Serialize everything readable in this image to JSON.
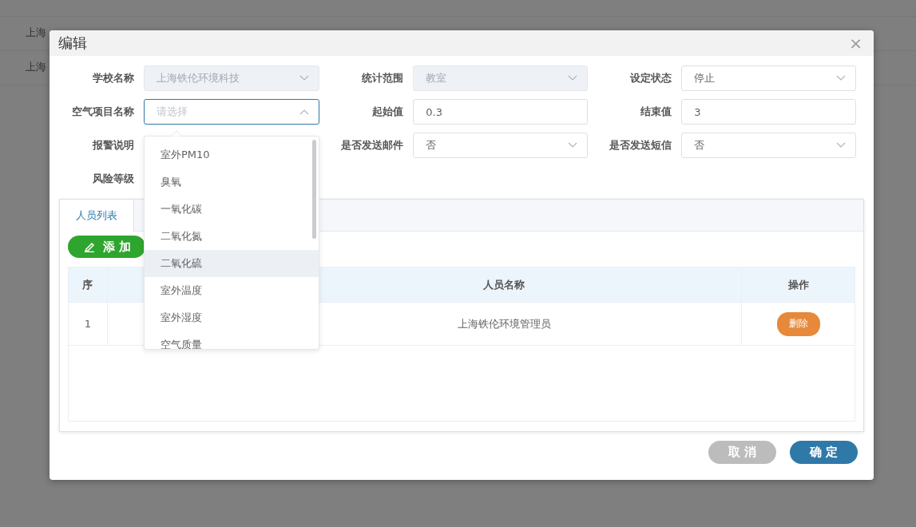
{
  "background_table": {
    "rows": [
      {
        "cells": [
          {
            "text": "上海"
          }
        ]
      },
      {
        "cells": [
          {
            "text": "上海"
          }
        ]
      }
    ]
  },
  "dialog": {
    "title": "编辑",
    "close": "×",
    "fields": [
      {
        "label": "学校名称",
        "kind": "select",
        "value": "上海铁伦环境科技",
        "disabled": true,
        "open": false
      },
      {
        "label": "统计范围",
        "kind": "select",
        "value": "教室",
        "disabled": true,
        "open": false
      },
      {
        "label": "设定状态",
        "kind": "select",
        "value": "停止",
        "disabled": false,
        "open": false
      },
      {
        "label": "空气项目名称",
        "kind": "select",
        "placeholder": "请选择",
        "disabled": false,
        "open": true
      },
      {
        "label": "起始值",
        "kind": "input",
        "value": "0.3"
      },
      {
        "label": "结束值",
        "kind": "input",
        "value": "3"
      },
      {
        "label": "报警说明",
        "kind": "hidden"
      },
      {
        "label": "是否发送邮件",
        "kind": "select",
        "value": "否",
        "disabled": false,
        "open": false
      },
      {
        "label": "是否发送短信",
        "kind": "select",
        "value": "否",
        "disabled": false,
        "open": false
      },
      {
        "label": "风险等级",
        "kind": "hidden"
      }
    ],
    "dropdown": {
      "options": [
        {
          "label": "室外PM10",
          "highlighted": false
        },
        {
          "label": "臭氧",
          "highlighted": false
        },
        {
          "label": "一氧化碳",
          "highlighted": false
        },
        {
          "label": "二氧化氮",
          "highlighted": false
        },
        {
          "label": "二氧化硫",
          "highlighted": true
        },
        {
          "label": "室外温度",
          "highlighted": false
        },
        {
          "label": "室外湿度",
          "highlighted": false
        },
        {
          "label": "空气质量",
          "highlighted": false
        }
      ]
    },
    "tabs": [
      {
        "label": "人员列表",
        "selected": true
      }
    ],
    "add_button": "添 加",
    "table": {
      "columns": [
        "序",
        "",
        "人员名称",
        "操作"
      ],
      "rows": [
        {
          "index": "1",
          "name": "上海铁伦环境管理员",
          "action": "删除"
        }
      ]
    },
    "buttons": [
      {
        "label": "取 消",
        "kind": "cancel"
      },
      {
        "label": "确 定",
        "kind": "primary"
      }
    ]
  }
}
